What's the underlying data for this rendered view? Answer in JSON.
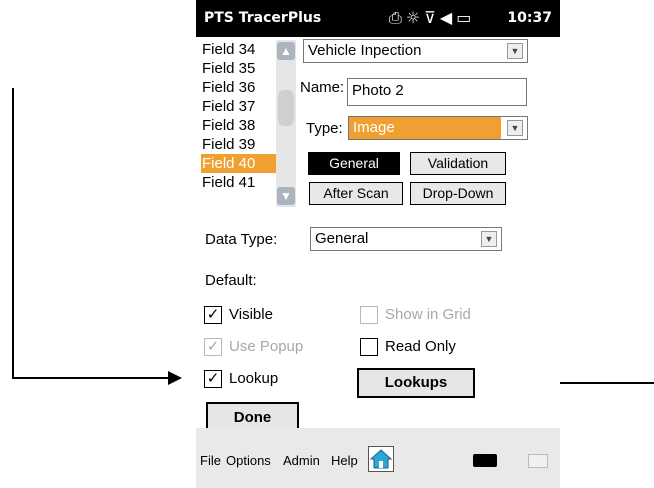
{
  "status_bar": {
    "app_title": "PTS TracerPlus",
    "time": "10:37",
    "icons": [
      "sync-icon",
      "connectivity-icon",
      "signal-off-icon",
      "volume-icon",
      "battery-charging-icon"
    ]
  },
  "field_list": {
    "items": [
      "Field 34",
      "Field 35",
      "Field 36",
      "Field 37",
      "Field 38",
      "Field 39",
      "Field 40",
      "Field 41"
    ],
    "selected": "Field 40"
  },
  "form": {
    "field_dropdown_value": "Vehicle Inpection",
    "name_label": "Name:",
    "name_value": "Photo 2",
    "type_label": "Type:",
    "type_value": "Image"
  },
  "tabs": {
    "general": "General",
    "validation": "Validation",
    "after_scan": "After Scan",
    "drop_down": "Drop-Down"
  },
  "settings": {
    "data_type_label": "Data Type:",
    "data_type_value": "General",
    "default_label": "Default:"
  },
  "checkboxes": {
    "visible": "Visible",
    "show_in_grid": "Show in Grid",
    "use_popup": "Use Popup",
    "read_only": "Read Only",
    "lookup": "Lookup"
  },
  "buttons": {
    "lookups": "Lookups",
    "done": "Done"
  },
  "menu": {
    "file": "File",
    "options": "Options",
    "admin": "Admin",
    "help": "Help"
  },
  "colors": {
    "selection": "#f0a030",
    "status_bar": "#000000",
    "menu_bar": "#e9e9e9"
  }
}
